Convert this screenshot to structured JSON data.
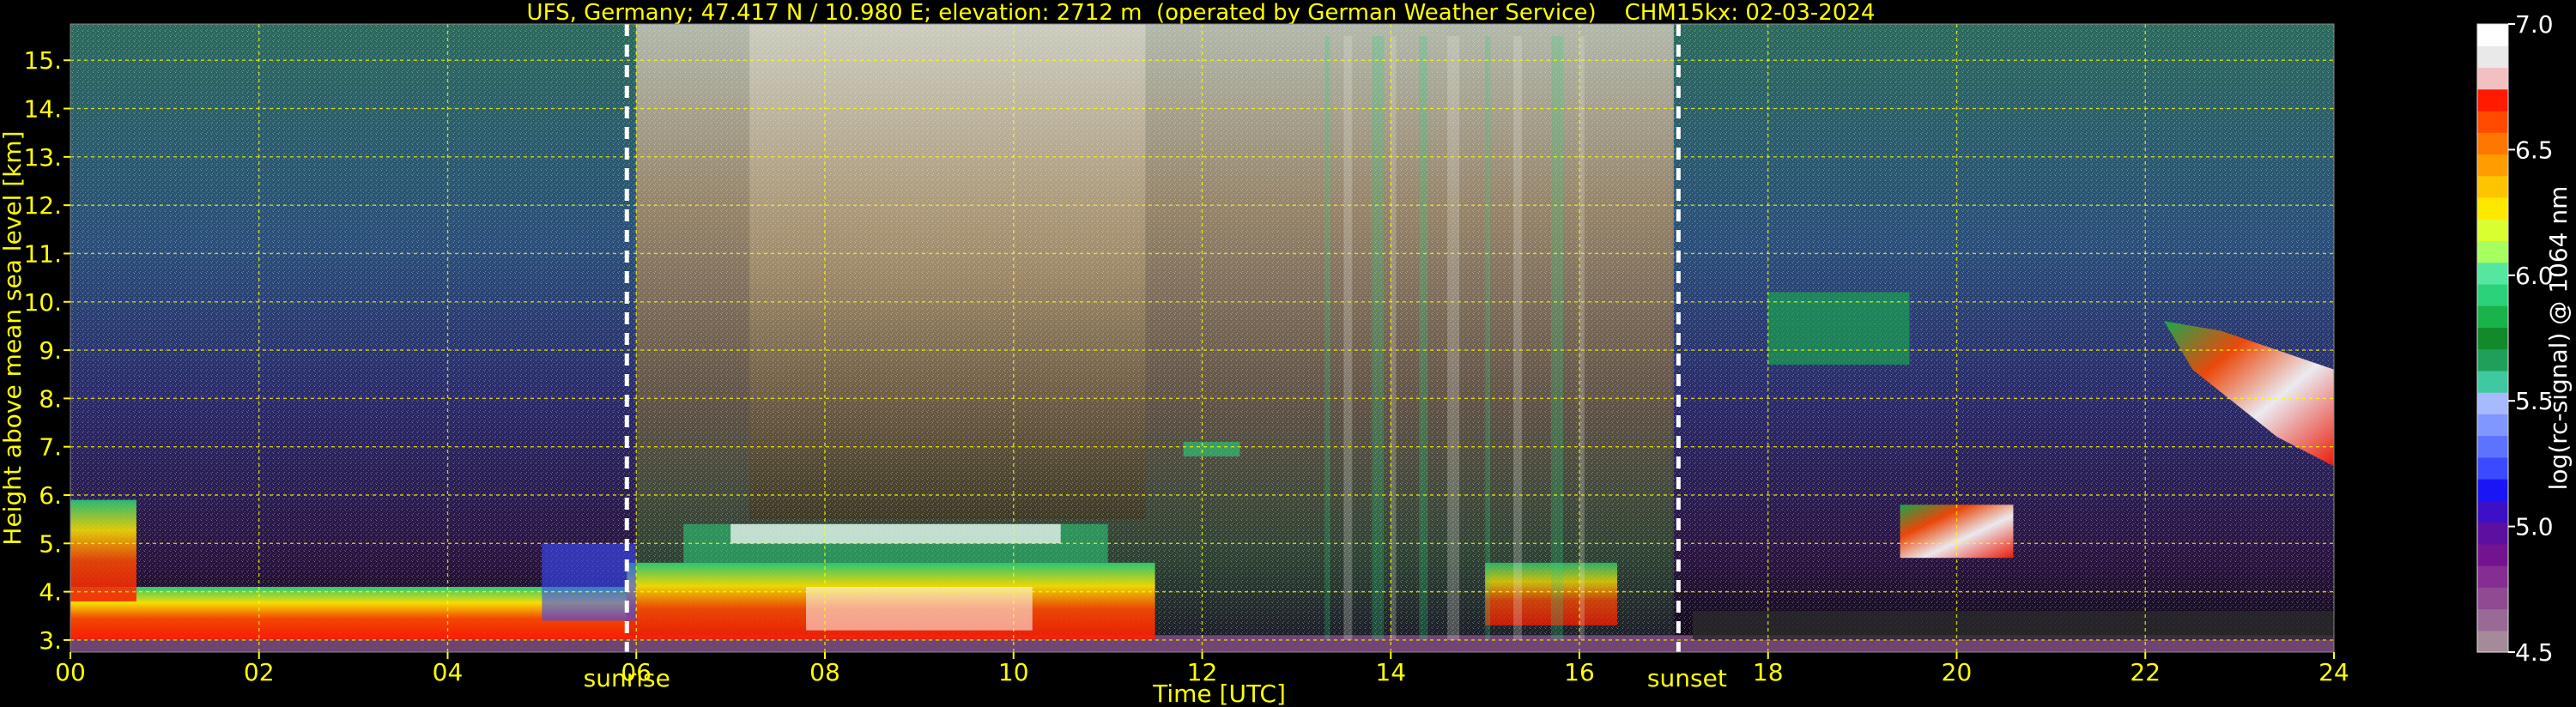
{
  "chart_data": {
    "type": "heatmap",
    "title": "UFS, Germany; 47.417 N / 10.980 E; elevation: 2712 m  (operated by German Weather Service)    CHM15kx: 02-03-2024",
    "xlabel": "Time [UTC]",
    "ylabel": "Height above mean sea level [km]",
    "xlim": [
      0,
      24
    ],
    "ylim": [
      2.75,
      15.75
    ],
    "x_ticks": [
      "00",
      "02",
      "04",
      "06",
      "08",
      "10",
      "12",
      "14",
      "16",
      "18",
      "20",
      "22",
      "24"
    ],
    "x_tick_values": [
      0,
      2,
      4,
      6,
      8,
      10,
      12,
      14,
      16,
      18,
      20,
      22,
      24
    ],
    "y_ticks": [
      "3.",
      "4.",
      "5.",
      "6.",
      "7.",
      "8.",
      "9.",
      "10.",
      "11.",
      "12.",
      "13.",
      "14.",
      "15."
    ],
    "y_tick_values": [
      3,
      4,
      5,
      6,
      7,
      8,
      9,
      10,
      11,
      12,
      13,
      14,
      15
    ],
    "grid": true,
    "annotations": [
      {
        "label": "sunrise",
        "x": 5.9
      },
      {
        "label": "sunset",
        "x": 17.05
      }
    ],
    "colorbar": {
      "label": "log(rc-signal) @ 1064 nm",
      "range": [
        4.5,
        7.0
      ],
      "ticks": [
        "7.0",
        "6.5",
        "6.0",
        "5.5",
        "5.0",
        "4.5"
      ],
      "tick_values": [
        7.0,
        6.5,
        6.0,
        5.5,
        5.0,
        4.5
      ],
      "colors": [
        "#a58a9a",
        "#9a6a96",
        "#8f4a92",
        "#862d91",
        "#73138f",
        "#5d0fa0",
        "#3d10c6",
        "#1a15f5",
        "#3a4bff",
        "#5c73ff",
        "#7f97ff",
        "#a7b9ff",
        "#40c9a0",
        "#1fa05a",
        "#128a2c",
        "#18b34a",
        "#2ad27a",
        "#55e7a0",
        "#a8ff60",
        "#d9ff30",
        "#ffe800",
        "#ffc400",
        "#ff9d00",
        "#ff7600",
        "#ff4a00",
        "#ff1a00",
        "#f2c0c0",
        "#e9e9e9",
        "#ffffff"
      ]
    }
  }
}
